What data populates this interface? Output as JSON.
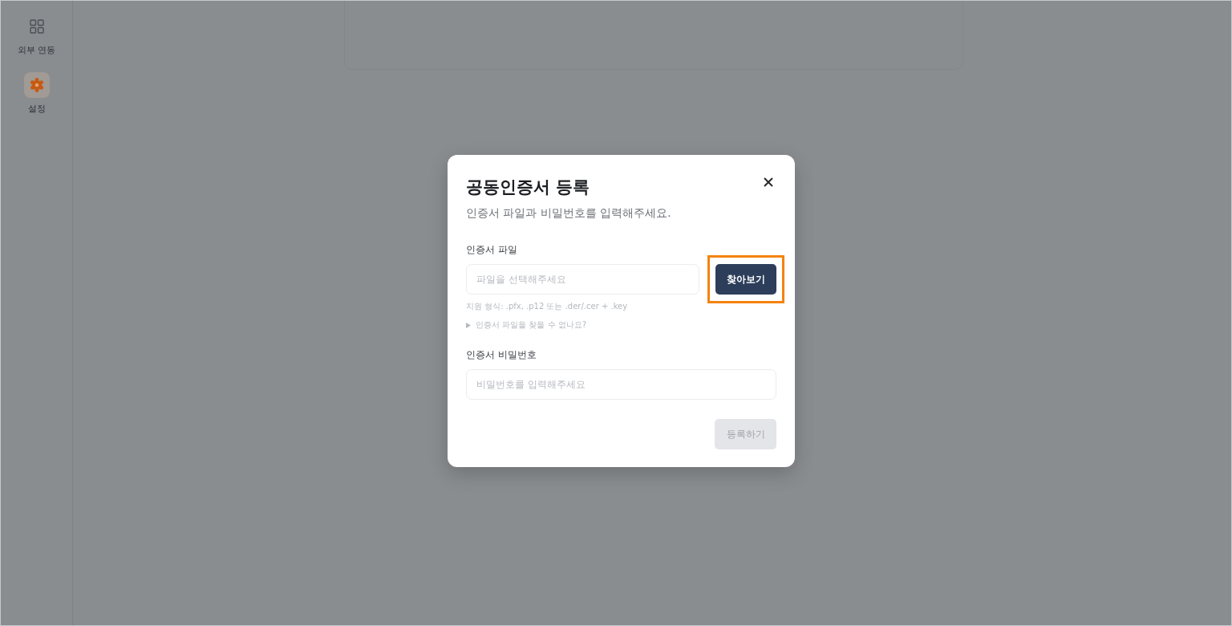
{
  "sidebar": {
    "items": [
      {
        "label": "외부 연동",
        "kind": "grid",
        "selected": false
      },
      {
        "label": "설정",
        "kind": "gear",
        "selected": true
      }
    ]
  },
  "dialog": {
    "title": "공동인증서 등록",
    "subtitle": "인증서 파일과 비밀번호를 입력해주세요.",
    "fields": [
      {
        "kind": "file",
        "label": "인증서 파일",
        "placeholder": "파일을 선택해주세요",
        "button": {
          "label": "찾아보기",
          "highlighted": true
        },
        "hint": "지원 형식: .pfx, .p12 또는 .der/.cer + .key",
        "help": {
          "label": "인증서 파일을 찾을 수 없나요?",
          "expanded": false
        }
      },
      {
        "kind": "password",
        "label": "인증서 비밀번호",
        "placeholder": "비밀번호를 입력해주세요"
      }
    ],
    "submit": {
      "label": "등록하기",
      "disabled": true
    }
  }
}
